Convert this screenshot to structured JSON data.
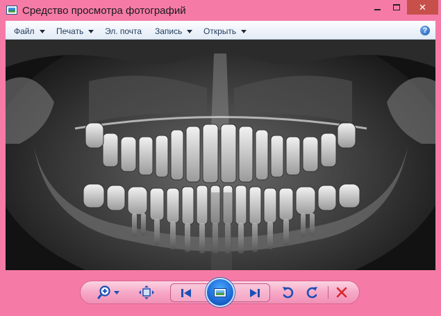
{
  "window": {
    "title": "Средство просмотра фотографий",
    "accent_color": "#f57ba6",
    "close_color": "#c7504a"
  },
  "window_controls": {
    "minimize_icon": "minimize-icon",
    "maximize_icon": "maximize-icon",
    "close_glyph": "✕"
  },
  "menu": {
    "items": [
      {
        "label": "Файл",
        "has_dropdown": true
      },
      {
        "label": "Печать",
        "has_dropdown": true
      },
      {
        "label": "Эл. почта",
        "has_dropdown": false
      },
      {
        "label": "Запись",
        "has_dropdown": true
      },
      {
        "label": "Открыть",
        "has_dropdown": true
      }
    ],
    "help_glyph": "?"
  },
  "image": {
    "subject": "dental panoramic x-ray",
    "background": "#0d0d0d"
  },
  "toolbar": {
    "buttons": [
      {
        "name": "zoom",
        "icon": "zoom-in-icon"
      },
      {
        "name": "actual-size",
        "icon": "fit-window-icon"
      },
      {
        "name": "previous",
        "icon": "previous-icon"
      },
      {
        "name": "slideshow",
        "icon": "slideshow-icon"
      },
      {
        "name": "next",
        "icon": "next-icon"
      },
      {
        "name": "rotate-counterclockwise",
        "icon": "rotate-left-icon"
      },
      {
        "name": "rotate-clockwise",
        "icon": "rotate-right-icon"
      },
      {
        "name": "delete",
        "icon": "delete-icon"
      }
    ],
    "delete_color": "#d8262a",
    "icon_color": "#1b4fb5"
  }
}
